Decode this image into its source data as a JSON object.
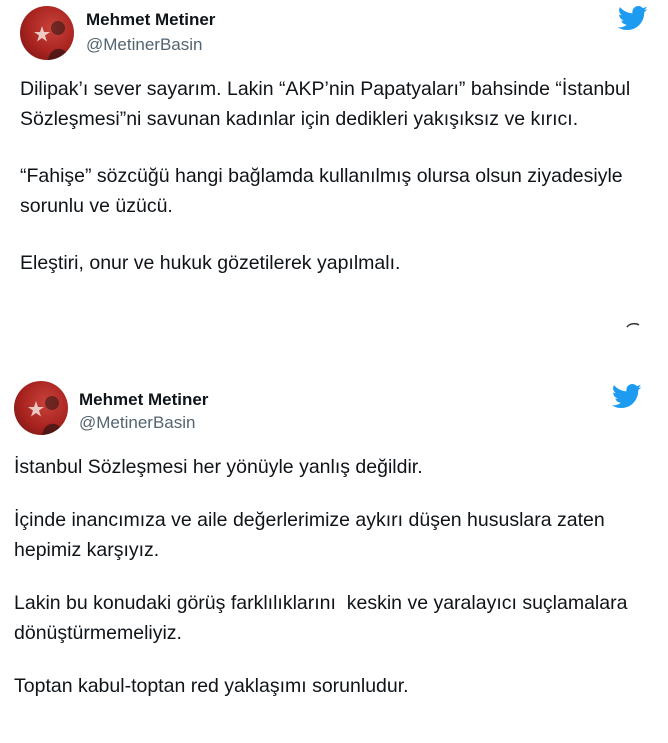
{
  "tweets": [
    {
      "author": {
        "name": "Mehmet Metiner",
        "handle": "@MetinerBasin"
      },
      "paragraphs": [
        "Dilipak’ı sever sayarım. Lakin “AKP’nin Papatyaları” bahsinde “İstanbul Sözleşmesi”ni savunan kadınlar için dedikleri yakışıksız ve kırıcı.",
        "“Fahişe” sözcüğü hangi bağlamda kullanılmış olursa olsun ziyadesiyle sorunlu ve üzücü.",
        "Eleştiri, onur ve hukuk gözetilerek yapılmalı."
      ]
    },
    {
      "author": {
        "name": "Mehmet Metiner",
        "handle": "@MetinerBasin"
      },
      "paragraphs": [
        "İstanbul Sözleşmesi her yönüyle yanlış değildir.",
        "İçinde inancımıza ve aile değerlerimize aykırı düşen hususlara zaten hepimiz karşıyız.",
        "Lakin bu konudaki görüş farklılıklarını  keskin ve yaralayıcı suçlamalara dönüştürmemeliyiz.",
        "Toptan kabul-toptan red yaklaşımı sorunludur."
      ]
    }
  ],
  "icons": {
    "platform": "twitter-bird-icon",
    "avatar": "profile-photo"
  },
  "colors": {
    "brand": "#1d9bf0",
    "text": "#0f1419",
    "muted": "#536471"
  }
}
